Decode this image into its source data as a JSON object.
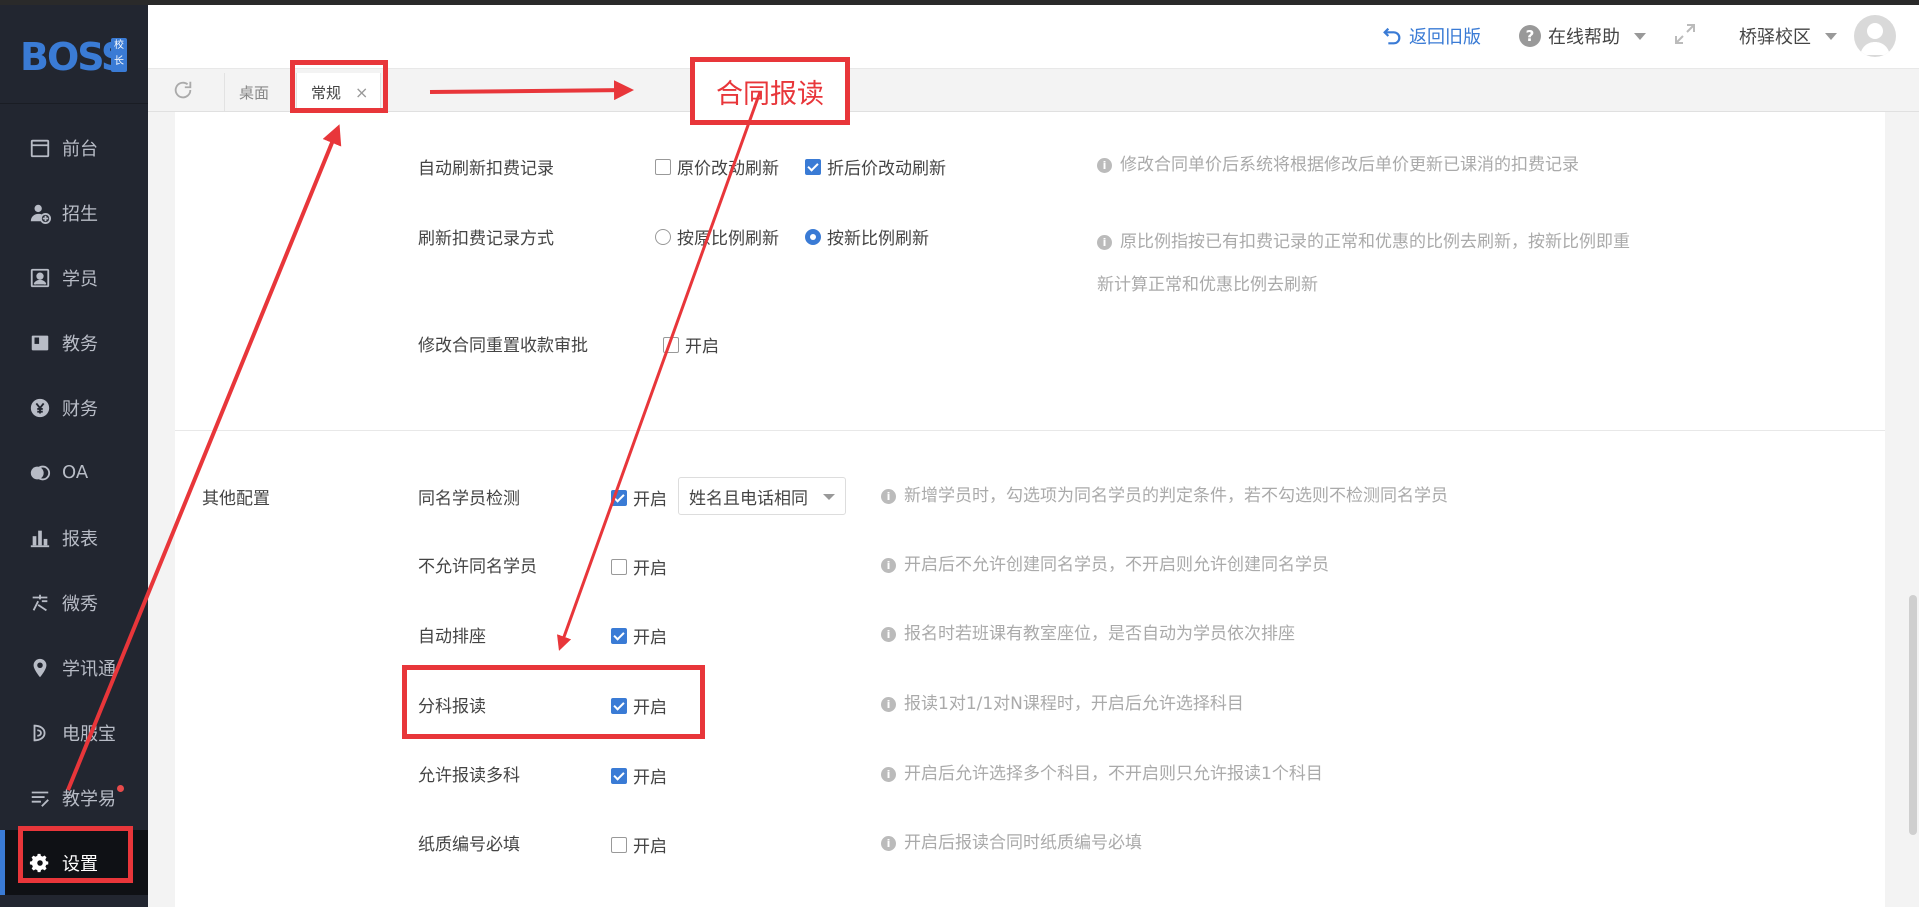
{
  "sidebar": {
    "logo_text": "BOSS",
    "logo_badge": "校长",
    "items": [
      {
        "label": "前台",
        "icon": "calendar-icon"
      },
      {
        "label": "招生",
        "icon": "user-add-icon"
      },
      {
        "label": "学员",
        "icon": "id-card-icon"
      },
      {
        "label": "教务",
        "icon": "book-icon"
      },
      {
        "label": "财务",
        "icon": "yuan-icon"
      },
      {
        "label": "OA",
        "icon": "chat-bubbles-icon"
      },
      {
        "label": "报表",
        "icon": "bar-chart-icon"
      },
      {
        "label": "微秀",
        "icon": "weixiu-icon"
      },
      {
        "label": "学讯通",
        "icon": "location-pin-icon"
      },
      {
        "label": "电服宝",
        "icon": "phone-service-icon"
      },
      {
        "label": "教学易",
        "icon": "book-pen-icon",
        "has_dot": true
      },
      {
        "label": "设置",
        "icon": "gear-icon",
        "active": true
      }
    ]
  },
  "header": {
    "back_old": "返回旧版",
    "help": "在线帮助",
    "campus": "桥驿校区"
  },
  "tabs": [
    {
      "label": "桌面"
    },
    {
      "label": "常规",
      "active": true,
      "close": "×"
    }
  ],
  "settings": {
    "auto_refresh": {
      "label": "自动刷新扣费记录",
      "opt1": "原价改动刷新",
      "opt1_checked": false,
      "opt2": "折后价改动刷新",
      "opt2_checked": true,
      "hint": "修改合同单价后系统将根据修改后单价更新已课消的扣费记录"
    },
    "refresh_mode": {
      "label": "刷新扣费记录方式",
      "opt1": "按原比例刷新",
      "opt1_checked": false,
      "opt2": "按新比例刷新",
      "opt2_checked": true,
      "hint_line1": "原比例指按已有扣费记录的正常和优惠的比例去刷新，按新比例即重",
      "hint_line2": "新计算正常和优惠比例去刷新"
    },
    "reset_approval": {
      "label": "修改合同重置收款审批",
      "opt": "开启",
      "checked": false
    },
    "other_section_title": "其他配置",
    "rows": [
      {
        "label": "同名学员检测",
        "opt": "开启",
        "checked": true,
        "select": "姓名且电话相同",
        "hint": "新增学员时，勾选项为同名学员的判定条件，若不勾选则不检测同名学员"
      },
      {
        "label": "不允许同名学员",
        "opt": "开启",
        "checked": false,
        "hint": "开启后不允许创建同名学员，不开启则允许创建同名学员"
      },
      {
        "label": "自动排座",
        "opt": "开启",
        "checked": true,
        "hint": "报名时若班课有教室座位，是否自动为学员依次排座"
      },
      {
        "label": "分科报读",
        "opt": "开启",
        "checked": true,
        "hint": "报读1对1/1对N课程时，开启后允许选择科目"
      },
      {
        "label": "允许报读多科",
        "opt": "开启",
        "checked": true,
        "hint": "开启后允许选择多个科目，不开启则只允许报读1个科目"
      },
      {
        "label": "纸质编号必填",
        "opt": "开启",
        "checked": false,
        "hint": "开启后报读合同时纸质编号必填"
      }
    ]
  },
  "annotation": {
    "title": "合同报读",
    "color": "#e8363a"
  }
}
